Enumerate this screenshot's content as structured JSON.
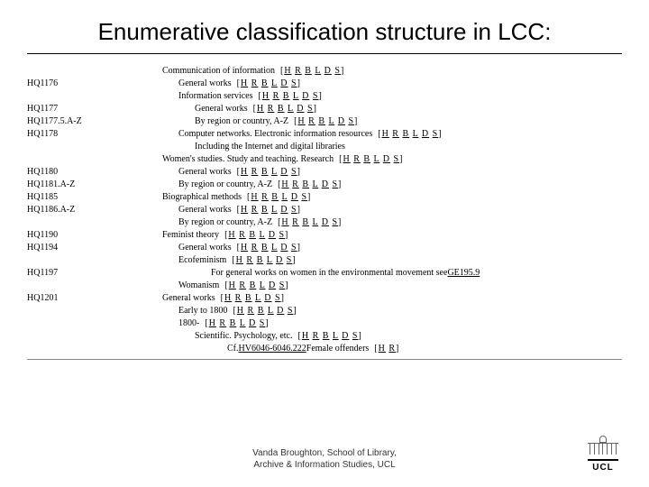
{
  "title": "Enumerative classification structure in LCC:",
  "leftGroups": [
    {
      "pre": 1,
      "codes": [
        "HQ1176"
      ]
    },
    {
      "pre": 1,
      "codes": [
        "HQ1177",
        "HQ1177.5.A-Z",
        "HQ1178"
      ]
    },
    {
      "pre": 2,
      "codes": [
        "HQ1180",
        "HQ1181.A-Z"
      ]
    },
    {
      "pre": 0,
      "codes": [
        "HQ1185",
        "HQ1186.A-Z"
      ]
    },
    {
      "pre": 1,
      "codes": [
        "HQ1190",
        "HQ1194"
      ]
    },
    {
      "pre": 1,
      "codes": [
        "HQ1197"
      ]
    },
    {
      "pre": 1,
      "codes": [
        "HQ1201"
      ]
    }
  ],
  "rightLines": [
    {
      "indent": 0,
      "text": "Communication of information",
      "bracket": "H R B L D S"
    },
    {
      "indent": 1,
      "text": "General works",
      "bracket": "H R B L D S"
    },
    {
      "indent": 1,
      "text": "Information services",
      "bracket": "H R B L D S"
    },
    {
      "indent": 2,
      "text": "General works",
      "bracket": "H R B L D S"
    },
    {
      "indent": 2,
      "text": "By region or country, A-Z",
      "bracket": "H R B L D S"
    },
    {
      "indent": 1,
      "text": "Computer networks. Electronic information resources",
      "bracket": "H R B L D S"
    },
    {
      "indent": 2,
      "text": "Including the Internet and digital libraries"
    },
    {
      "indent": 0,
      "text": "Women's studies. Study and teaching. Research",
      "bracket": "H R B L D S"
    },
    {
      "indent": 1,
      "text": "General works",
      "bracket": "H R B L D S"
    },
    {
      "indent": 1,
      "text": "By region or country, A-Z",
      "bracket": "H R B L D S"
    },
    {
      "indent": 0,
      "text": "Biographical methods",
      "bracket": "H R B L D S"
    },
    {
      "indent": 1,
      "text": "General works",
      "bracket": "H R B L D S"
    },
    {
      "indent": 1,
      "text": "By region or country, A-Z",
      "bracket": "H R B L D S"
    },
    {
      "indent": 0,
      "text": "Feminist theory",
      "bracket": "H R B L D S"
    },
    {
      "indent": 1,
      "text": "General works",
      "bracket": "H R B L D S"
    },
    {
      "indent": 1,
      "text": "Ecofeminism",
      "bracket": "H R B L D S"
    },
    {
      "indent": 3,
      "text": "For general works on women in the environmental movement see ",
      "seeLink": "GE195.9"
    },
    {
      "indent": 1,
      "text": "Womanism",
      "bracket": "H R B L D S"
    },
    {
      "indent": 0,
      "text": "General works",
      "bracket": "H R B L D S"
    },
    {
      "indent": 1,
      "text": "Early to 1800",
      "bracket": "H R B L D S"
    },
    {
      "indent": 1,
      "text": "1800-",
      "bracket": "H R B L D S"
    },
    {
      "indent": 2,
      "text": "Scientific. Psychology, etc.",
      "bracket": "H R B L D S"
    },
    {
      "indent": 4,
      "text": "Cf. ",
      "cfLink": "HV6046-6046.222",
      "cfTail": " Female offenders",
      "cfBracket": "H R"
    }
  ],
  "footer": {
    "line1": "Vanda Broughton, School of Library,",
    "line2": "Archive & Information Studies, UCL"
  },
  "logo": "UCL"
}
